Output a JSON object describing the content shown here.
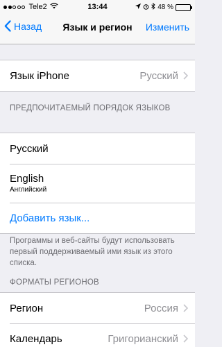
{
  "status_bar": {
    "carrier": "Tele2",
    "time": "13:44",
    "battery": "48 %",
    "battery_level": 0.48,
    "icons": [
      "location-arrow-icon",
      "alarm-icon",
      "bluetooth-icon"
    ]
  },
  "nav": {
    "back_label": "Назад",
    "title": "Язык и регион",
    "action_label": "Изменить"
  },
  "language_row": {
    "label": "Язык iPhone",
    "value": "Русский"
  },
  "preferred_section": {
    "header": "ПРЕДПОЧИТАЕМЫЙ ПОРЯДОК ЯЗЫКОВ",
    "languages": [
      {
        "name": "Русский",
        "subtitle": ""
      },
      {
        "name": "English",
        "subtitle": "Английский"
      }
    ],
    "add_label": "Добавить язык...",
    "footer": "Программы и веб-сайты будут использовать первый поддерживаемый ими язык из этого списка."
  },
  "formats_section": {
    "header": "ФОРМАТЫ РЕГИОНОВ",
    "rows": [
      {
        "label": "Регион",
        "value": "Россия"
      },
      {
        "label": "Календарь",
        "value": "Григорианский"
      }
    ]
  },
  "colors": {
    "accent": "#007aff",
    "background": "#efeff4",
    "secondary_text": "#8e8e93"
  }
}
